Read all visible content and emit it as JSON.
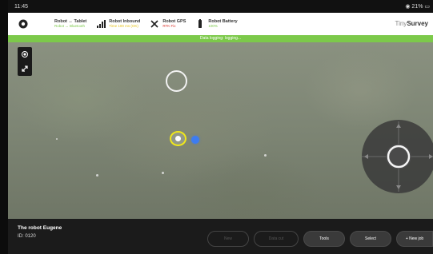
{
  "status_bar": {
    "time": "11:45",
    "right": "◉ 21% ▭"
  },
  "header": {
    "items": [
      {
        "title": "Robot ↔ Tablet",
        "subtitle": "Robot ↔ Bluetooth",
        "subtitle_color": "#7cc94a"
      },
      {
        "title": "Robot Inbound",
        "subtitle": "Time 100 ms (OK)",
        "subtitle_color": "#e6c21a"
      },
      {
        "title": "Robot GPS",
        "subtitle": "RTK Fix",
        "subtitle_color": "#d9352b"
      },
      {
        "title": "Robot Battery",
        "subtitle": "100%",
        "subtitle_color": "#7cc94a"
      }
    ],
    "brand_light": "Tiny",
    "brand_bold": "Survey"
  },
  "banner": {
    "text": "Data logging: logging..."
  },
  "bottom": {
    "robot_name": "The robot Eugene",
    "robot_id": "ID: 0120",
    "buttons": {
      "new": "New",
      "data_cut": "Data cut",
      "tools": "Tools",
      "select": "Select",
      "new_job": "+ New job"
    }
  },
  "colors": {
    "accent_green": "#7cc94a",
    "robot_marker": "#f0e81a",
    "tablet_marker": "#3d7cf0"
  }
}
